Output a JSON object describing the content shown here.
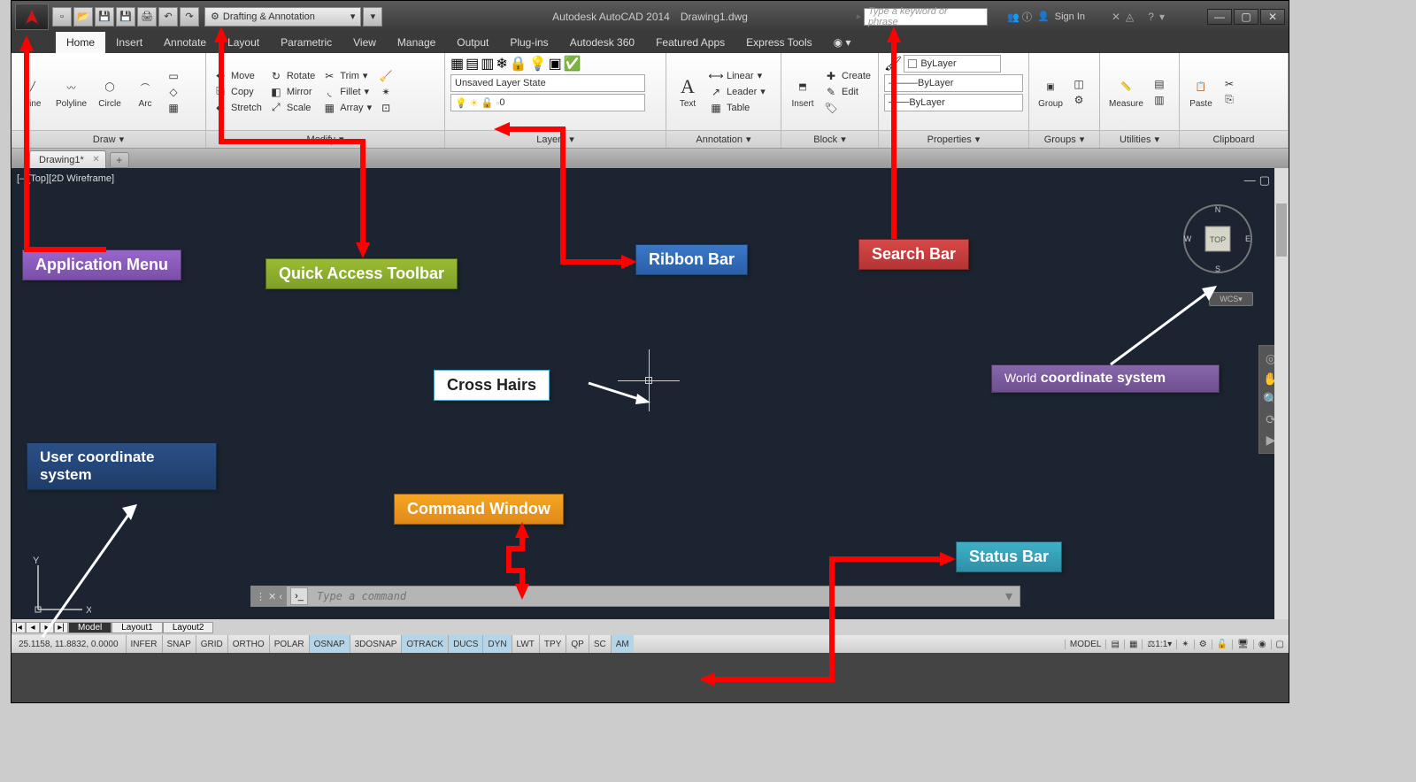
{
  "title": {
    "app": "Autodesk AutoCAD 2014",
    "file": "Drawing1.dwg"
  },
  "search": {
    "placeholder": "Type a keyword or phrase"
  },
  "signin": {
    "label": "Sign In"
  },
  "workspace": {
    "label": "Drafting & Annotation"
  },
  "tabs": [
    "Home",
    "Insert",
    "Annotate",
    "Layout",
    "Parametric",
    "View",
    "Manage",
    "Output",
    "Plug-ins",
    "Autodesk 360",
    "Featured Apps",
    "Express Tools"
  ],
  "activeTab": "Home",
  "filetab": {
    "name": "Drawing1*"
  },
  "viewport": {
    "label": "[–][Top][2D Wireframe]"
  },
  "wcs": {
    "label": "WCS"
  },
  "viewcube": {
    "face": "TOP",
    "n": "N",
    "e": "E",
    "s": "S",
    "w": "W"
  },
  "ucs": {
    "x": "X",
    "y": "Y"
  },
  "cmd": {
    "placeholder": "Type a command"
  },
  "layouts": [
    "Model",
    "Layout1",
    "Layout2"
  ],
  "activeLayout": "Model",
  "coords": "25.1158, 11.8832, 0.0000",
  "status_toggles": [
    "INFER",
    "SNAP",
    "GRID",
    "ORTHO",
    "POLAR",
    "OSNAP",
    "3DOSNAP",
    "OTRACK",
    "DUCS",
    "DYN",
    "LWT",
    "TPY",
    "QP",
    "SC",
    "AM"
  ],
  "status_on": [
    "OSNAP",
    "OTRACK",
    "DUCS",
    "DYN",
    "AM"
  ],
  "status_right": {
    "model": "MODEL",
    "scale": "1:1"
  },
  "ribbon": {
    "draw": {
      "title": "Draw",
      "line": "Line",
      "polyline": "Polyline",
      "circle": "Circle",
      "arc": "Arc"
    },
    "modify": {
      "title": "Modify",
      "move": "Move",
      "copy": "Copy",
      "stretch": "Stretch",
      "rotate": "Rotate",
      "mirror": "Mirror",
      "scale": "Scale",
      "trim": "Trim",
      "fillet": "Fillet",
      "array": "Array"
    },
    "layers": {
      "title": "Layers",
      "state": "Unsaved Layer State",
      "current": "0"
    },
    "annotation": {
      "title": "Annotation",
      "text": "Text",
      "linear": "Linear",
      "leader": "Leader",
      "table": "Table"
    },
    "block": {
      "title": "Block",
      "insert": "Insert",
      "create": "Create",
      "edit": "Edit"
    },
    "properties": {
      "title": "Properties",
      "bylayer": "ByLayer"
    },
    "groups": {
      "title": "Groups",
      "group": "Group"
    },
    "utilities": {
      "title": "Utilities",
      "measure": "Measure"
    },
    "clipboard": {
      "title": "Clipboard",
      "paste": "Paste"
    }
  },
  "callouts": {
    "appmenu": "Application Menu",
    "qat": "Quick Access Toolbar",
    "ribbon": "Ribbon  Bar",
    "search": "Search  Bar",
    "crosshair": "Cross Hairs",
    "wcs_label": "World coordinate system",
    "ucs_label": "User coordinate system",
    "cmd": "Command Window",
    "status": "Status  Bar"
  }
}
